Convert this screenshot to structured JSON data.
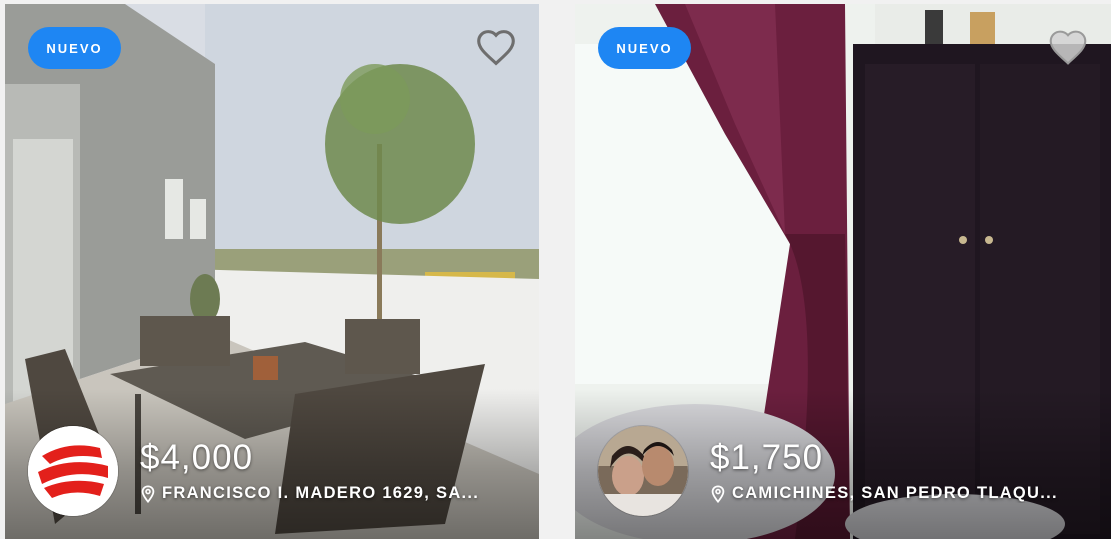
{
  "listings": [
    {
      "badge": "NUEVO",
      "price": "$4,000",
      "address": "FRANCISCO I. MADERO 1629, SA...",
      "favorite_icon": "heart-outline-icon",
      "location_icon": "map-pin-icon"
    },
    {
      "badge": "NUEVO",
      "price": "$1,750",
      "address": "CAMICHINES, SAN PEDRO TLAQU...",
      "favorite_icon": "heart-outline-icon",
      "location_icon": "map-pin-icon"
    }
  ],
  "colors": {
    "badge_bg": "#1e86f3",
    "text": "#ffffff",
    "logo_red": "#e3201b"
  }
}
